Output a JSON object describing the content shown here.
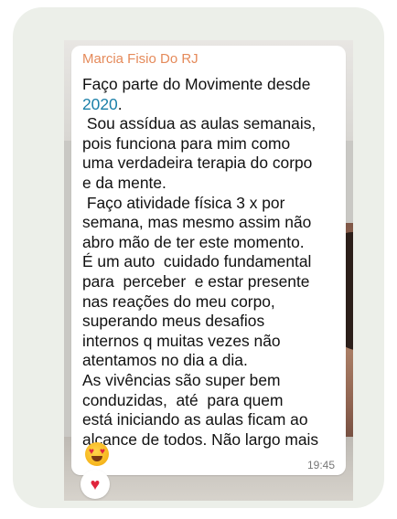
{
  "message": {
    "sender": "Marcia Fisio Do RJ",
    "text_before_link": "Faço parte do Movimente desde\n",
    "link_text": "2020",
    "text_after_link": ".\n Sou assídua as aulas semanais,\npois funciona para mim como\numa verdadeira terapia do corpo\ne da mente.\n Faço atividade física 3 x por\nsemana, mas mesmo assim não\nabro mão de ter este momento.\nÉ um auto  cuidado fundamental\npara  perceber  e estar presente\nnas reações do meu corpo,\nsuperando meus desafios\ninternos q muitas vezes não\natentamos no dia a dia.\nAs vivências são super bem\nconduzidas,  até  para quem\nestá iniciando as aulas ficam ao\nalcance de todos. Não largo mais",
    "emoji_icon": "smiling-face-with-heart-eyes-icon",
    "timestamp": "19:45",
    "reaction_icon": "red-heart-icon"
  },
  "colors": {
    "sender": "#e58a5a",
    "link": "#1a7fa8",
    "bubble": "#ffffff",
    "card": "#ecefe9"
  }
}
